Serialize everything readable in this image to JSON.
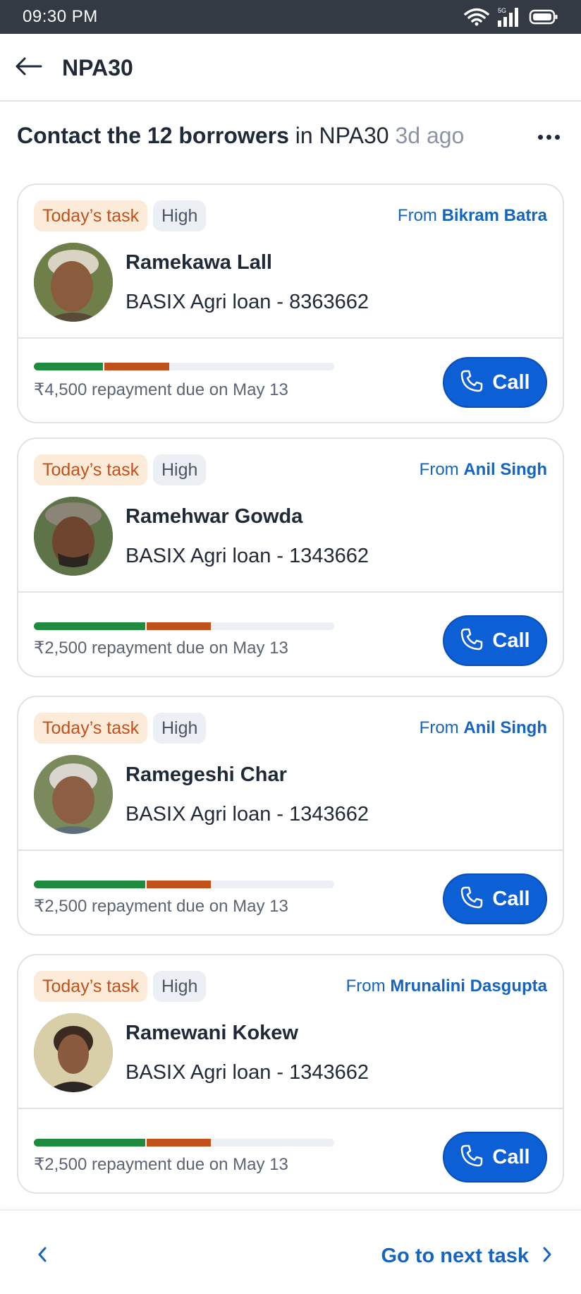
{
  "status_bar": {
    "time": "09:30 PM",
    "network": "5G"
  },
  "app_bar": {
    "title": "NPA30"
  },
  "header": {
    "title_bold": "Contact the 12 borrowers",
    "title_context": "in NPA30",
    "age": "3d ago"
  },
  "colors": {
    "accent": "#0d5fd6",
    "link": "#1565c0",
    "task_tag_bg": "#fdebd9",
    "task_tag_text": "#c2501a",
    "progress_paid": "#1e8b3e",
    "progress_overdue": "#c2501a"
  },
  "tasks": [
    {
      "tag": "Today’s task",
      "priority": "High",
      "from_prefix": "From",
      "assigner": "Bikram Batra",
      "name": "Ramekawa Lall",
      "loan": "BASIX Agri loan - 8363662",
      "due": "₹4,500 repayment due on May 13",
      "progress_paid": 0.23,
      "progress_overdue": 0.22,
      "call_label": "Call"
    },
    {
      "tag": "Today’s task",
      "priority": "High",
      "from_prefix": "From",
      "assigner": "Anil Singh",
      "name": "Ramehwar Gowda",
      "loan": "BASIX Agri loan - 1343662",
      "due": "₹2,500 repayment due on May 13",
      "progress_paid": 0.37,
      "progress_overdue": 0.22,
      "call_label": "Call"
    },
    {
      "tag": "Today’s task",
      "priority": "High",
      "from_prefix": "From",
      "assigner": "Anil Singh",
      "name": "Ramegeshi Char",
      "loan": "BASIX Agri loan - 1343662",
      "due": "₹2,500 repayment due on May 13",
      "progress_paid": 0.37,
      "progress_overdue": 0.22,
      "call_label": "Call"
    },
    {
      "tag": "Today’s task",
      "priority": "High",
      "from_prefix": "From",
      "assigner": "Mrunalini Dasgupta",
      "name": "Ramewani Kokew",
      "loan": "BASIX Agri loan - 1343662",
      "due": "₹2,500 repayment due on May 13",
      "progress_paid": 0.37,
      "progress_overdue": 0.22,
      "call_label": "Call"
    }
  ],
  "bottom_nav": {
    "next_label": "Go to next task"
  }
}
